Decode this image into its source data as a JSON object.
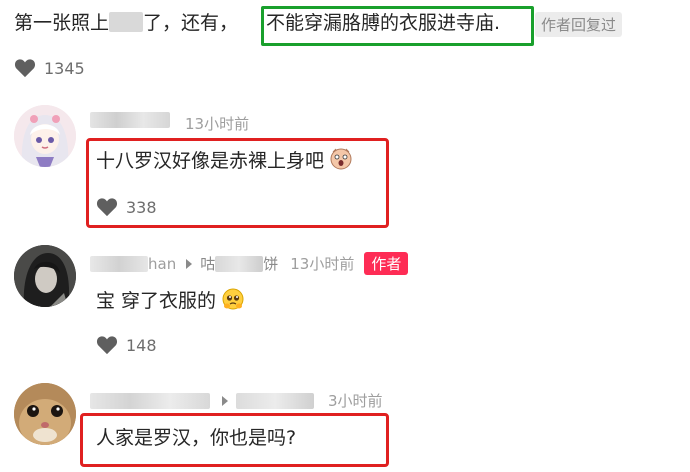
{
  "post": {
    "text_start": "第一张照上",
    "text_mid": "了，还有，",
    "highlight": "不能穿漏胳膊的衣服进寺庙.",
    "author_badge": "作者回复过",
    "likes": "1345"
  },
  "comments": [
    {
      "username_suffix": "",
      "time": "13小时前",
      "text": "十八罗汉好像是赤裸上身吧",
      "emoji_icon": "shocked-face-icon",
      "likes": "338"
    },
    {
      "username_suffix": "han",
      "reply_to_prefix": "咕",
      "reply_to_suffix": "饼",
      "time": "13小时前",
      "author_badge": "作者",
      "text": "宝 穿了衣服的",
      "emoji_icon": "pleading-face-icon",
      "likes": "148"
    },
    {
      "time": "3小时前",
      "text": "人家是罗汉，你也是吗?"
    }
  ],
  "colors": {
    "red_box": "#e02020",
    "green_box": "#19a02c",
    "author_badge_bg": "#fe2c55"
  }
}
